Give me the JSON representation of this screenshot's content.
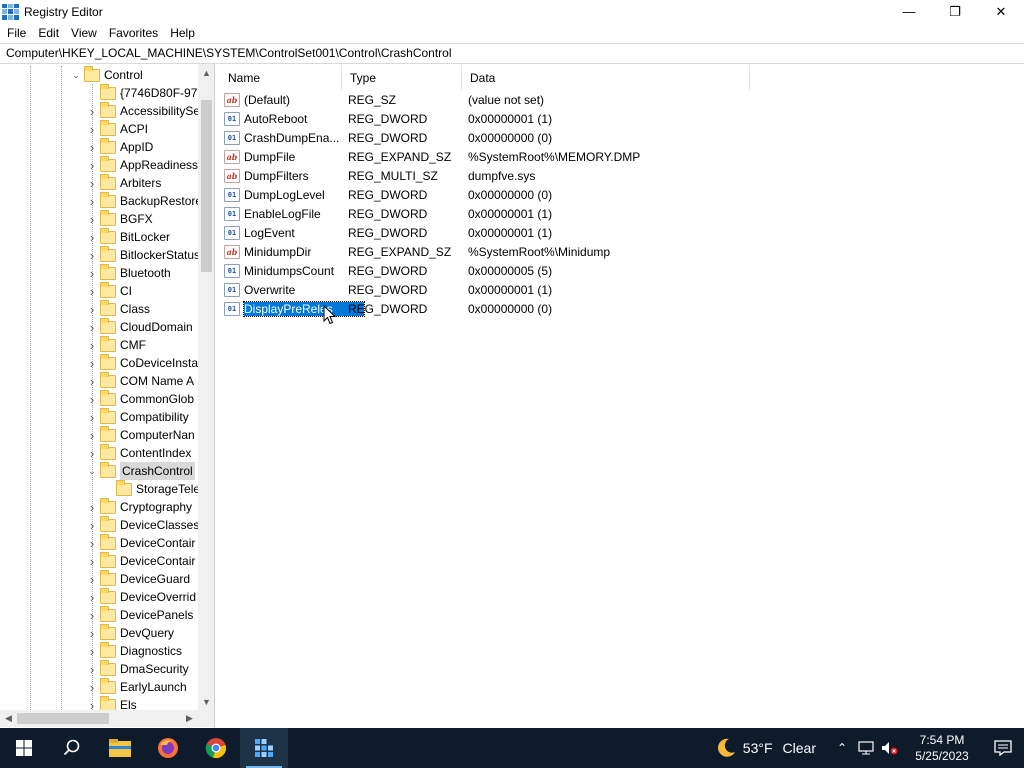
{
  "window": {
    "title": "Registry Editor",
    "minimize": "—",
    "maximize": "❐",
    "close": "✕"
  },
  "menu": [
    "File",
    "Edit",
    "View",
    "Favorites",
    "Help"
  ],
  "address": "Computer\\HKEY_LOCAL_MACHINE\\SYSTEM\\ControlSet001\\Control\\CrashControl",
  "tree": {
    "parent": "Control",
    "items": [
      {
        "label": "{7746D80F-97E",
        "expander": false
      },
      {
        "label": "AccessibilitySe",
        "expander": true
      },
      {
        "label": "ACPI",
        "expander": true
      },
      {
        "label": "AppID",
        "expander": true
      },
      {
        "label": "AppReadiness",
        "expander": true
      },
      {
        "label": "Arbiters",
        "expander": true
      },
      {
        "label": "BackupRestore",
        "expander": true
      },
      {
        "label": "BGFX",
        "expander": true
      },
      {
        "label": "BitLocker",
        "expander": true
      },
      {
        "label": "BitlockerStatus",
        "expander": true
      },
      {
        "label": "Bluetooth",
        "expander": true
      },
      {
        "label": "CI",
        "expander": true
      },
      {
        "label": "Class",
        "expander": true
      },
      {
        "label": "CloudDomain",
        "expander": true
      },
      {
        "label": "CMF",
        "expander": true
      },
      {
        "label": "CoDeviceInsta",
        "expander": true
      },
      {
        "label": "COM Name A",
        "expander": true
      },
      {
        "label": "CommonGlob",
        "expander": true
      },
      {
        "label": "Compatibility",
        "expander": true
      },
      {
        "label": "ComputerNan",
        "expander": true
      },
      {
        "label": "ContentIndex",
        "expander": true
      },
      {
        "label": "CrashControl",
        "expander": true,
        "expanded": true,
        "selected": true
      },
      {
        "label": "StorageTele",
        "expander": false,
        "child": true
      },
      {
        "label": "Cryptography",
        "expander": true
      },
      {
        "label": "DeviceClasses",
        "expander": true
      },
      {
        "label": "DeviceContair",
        "expander": true
      },
      {
        "label": "DeviceContair",
        "expander": true
      },
      {
        "label": "DeviceGuard",
        "expander": true
      },
      {
        "label": "DeviceOverrid",
        "expander": true
      },
      {
        "label": "DevicePanels",
        "expander": true
      },
      {
        "label": "DevQuery",
        "expander": true
      },
      {
        "label": "Diagnostics",
        "expander": true
      },
      {
        "label": "DmaSecurity",
        "expander": true
      },
      {
        "label": "EarlyLaunch",
        "expander": true
      },
      {
        "label": "Els",
        "expander": true
      }
    ]
  },
  "list": {
    "columns": {
      "name": "Name",
      "type": "Type",
      "data": "Data"
    },
    "rows": [
      {
        "name": "(Default)",
        "type": "REG_SZ",
        "data": "(value not set)",
        "icon": "string-value-icon"
      },
      {
        "name": "AutoReboot",
        "type": "REG_DWORD",
        "data": "0x00000001 (1)",
        "icon": "dword-value-icon"
      },
      {
        "name": "CrashDumpEna...",
        "type": "REG_DWORD",
        "data": "0x00000000 (0)",
        "icon": "dword-value-icon"
      },
      {
        "name": "DumpFile",
        "type": "REG_EXPAND_SZ",
        "data": "%SystemRoot%\\MEMORY.DMP",
        "icon": "string-value-icon"
      },
      {
        "name": "DumpFilters",
        "type": "REG_MULTI_SZ",
        "data": "dumpfve.sys",
        "icon": "string-value-icon"
      },
      {
        "name": "DumpLogLevel",
        "type": "REG_DWORD",
        "data": "0x00000000 (0)",
        "icon": "dword-value-icon"
      },
      {
        "name": "EnableLogFile",
        "type": "REG_DWORD",
        "data": "0x00000001 (1)",
        "icon": "dword-value-icon"
      },
      {
        "name": "LogEvent",
        "type": "REG_DWORD",
        "data": "0x00000001 (1)",
        "icon": "dword-value-icon"
      },
      {
        "name": "MinidumpDir",
        "type": "REG_EXPAND_SZ",
        "data": "%SystemRoot%\\Minidump",
        "icon": "string-value-icon"
      },
      {
        "name": "MinidumpsCount",
        "type": "REG_DWORD",
        "data": "0x00000005 (5)",
        "icon": "dword-value-icon"
      },
      {
        "name": "Overwrite",
        "type": "REG_DWORD",
        "data": "0x00000001 (1)",
        "icon": "dword-value-icon"
      },
      {
        "name": "DisplayPreReles",
        "type": "REG_DWORD",
        "data": "0x00000000 (0)",
        "icon": "dword-value-icon",
        "selected": true
      }
    ]
  },
  "taskbar": {
    "apps": [
      "start-icon",
      "search-icon",
      "file-explorer-icon",
      "firefox-icon",
      "chrome-icon",
      "registry-editor-icon"
    ],
    "weather_temp": "53°F",
    "weather_cond": "Clear",
    "time": "7:54 PM",
    "date": "5/25/2023",
    "accent": "#0078d7"
  }
}
